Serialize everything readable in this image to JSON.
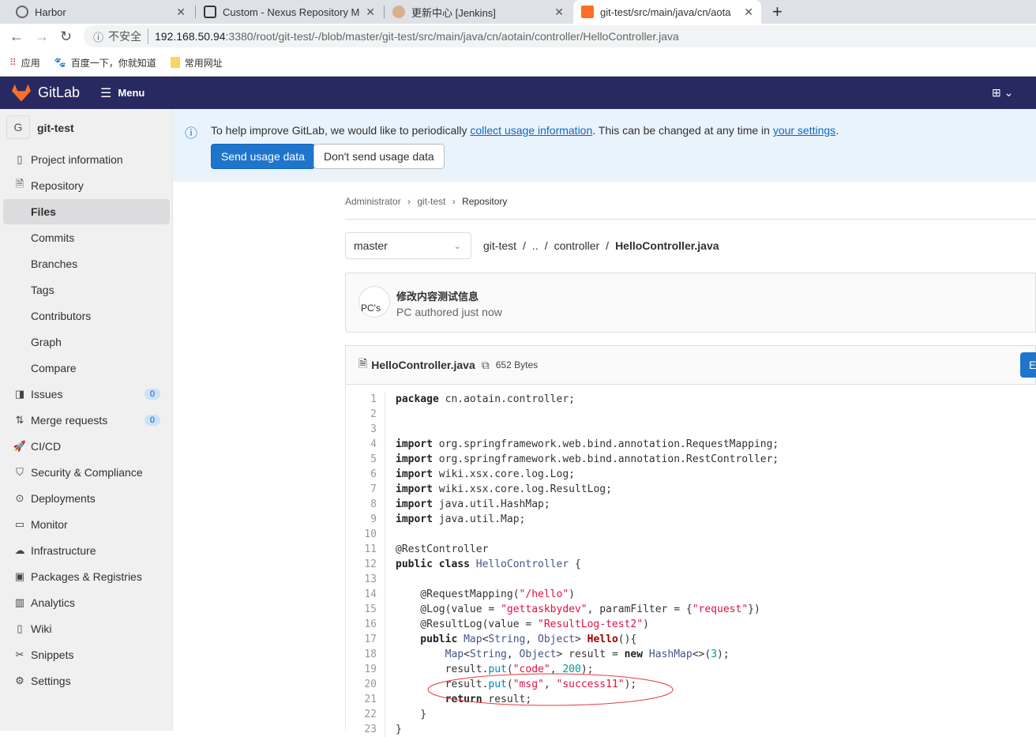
{
  "browser": {
    "tabs": [
      {
        "title": "Harbor"
      },
      {
        "title": "Custom - Nexus Repository M"
      },
      {
        "title": "更新中心 [Jenkins]"
      },
      {
        "title": "git-test/src/main/java/cn/aota",
        "active": true
      }
    ],
    "new_tab": "+",
    "security_label": "不安全",
    "url_host": "192.168.50.94",
    "url_path": ":3380/root/git-test/-/blob/master/git-test/src/main/java/cn/aotain/controller/HelloController.java",
    "bookmarks": [
      {
        "label": "应用",
        "icon": "apps-grid-icon"
      },
      {
        "label": "百度一下，你就知道",
        "icon": "baidu-paw-icon"
      },
      {
        "label": "常用网址",
        "icon": "folder-icon"
      }
    ]
  },
  "topnav": {
    "brand": "GitLab",
    "menu": "Menu"
  },
  "sidebar": {
    "project_initial": "G",
    "project_name": "git-test",
    "items": [
      {
        "label": "Project information",
        "icon": "info-doc-icon"
      },
      {
        "label": "Repository",
        "icon": "doc-icon"
      },
      {
        "label": "Files",
        "sub": true,
        "selected": true
      },
      {
        "label": "Commits",
        "sub": true
      },
      {
        "label": "Branches",
        "sub": true
      },
      {
        "label": "Tags",
        "sub": true
      },
      {
        "label": "Contributors",
        "sub": true
      },
      {
        "label": "Graph",
        "sub": true
      },
      {
        "label": "Compare",
        "sub": true
      },
      {
        "label": "Issues",
        "icon": "issues-icon",
        "badge": "0"
      },
      {
        "label": "Merge requests",
        "icon": "merge-request-icon",
        "badge": "0"
      },
      {
        "label": "CI/CD",
        "icon": "rocket-icon"
      },
      {
        "label": "Security & Compliance",
        "icon": "shield-icon"
      },
      {
        "label": "Deployments",
        "icon": "deployments-icon"
      },
      {
        "label": "Monitor",
        "icon": "monitor-icon"
      },
      {
        "label": "Infrastructure",
        "icon": "cloud-icon"
      },
      {
        "label": "Packages & Registries",
        "icon": "package-icon"
      },
      {
        "label": "Analytics",
        "icon": "chart-icon"
      },
      {
        "label": "Wiki",
        "icon": "book-icon"
      },
      {
        "label": "Snippets",
        "icon": "scissors-icon"
      },
      {
        "label": "Settings",
        "icon": "gear-icon"
      }
    ]
  },
  "banner": {
    "text1": "To help improve GitLab, we would like to periodically ",
    "link1": "collect usage information",
    "text2": ". This can be changed at any time in ",
    "link2": "your settings",
    "text3": ".",
    "send": "Send usage data",
    "dont_send": "Don't send usage data"
  },
  "breadcrumb": [
    "Administrator",
    "git-test",
    "Repository"
  ],
  "branch": "master",
  "path": [
    "git-test",
    "..",
    "controller",
    "HelloController.java"
  ],
  "commit": {
    "avatar_alt": "PC's",
    "message": "修改内容测试信息",
    "author": "PC",
    "meta": " authored just now"
  },
  "file": {
    "name": "HelloController.java",
    "size": "652 Bytes",
    "edit": "E"
  },
  "code_lines": [
    [
      [
        "kw",
        "package"
      ],
      [
        "",
        " cn.aotain.controller;"
      ]
    ],
    [],
    [],
    [
      [
        "kw",
        "import"
      ],
      [
        "",
        " org.springframework.web.bind.annotation.RequestMapping;"
      ]
    ],
    [
      [
        "kw",
        "import"
      ],
      [
        "",
        " org.springframework.web.bind.annotation.RestController;"
      ]
    ],
    [
      [
        "kw",
        "import"
      ],
      [
        "",
        " wiki.xsx.core.log.Log;"
      ]
    ],
    [
      [
        "kw",
        "import"
      ],
      [
        "",
        " wiki.xsx.core.log.ResultLog;"
      ]
    ],
    [
      [
        "kw",
        "import"
      ],
      [
        "",
        " java.util.HashMap;"
      ]
    ],
    [
      [
        "kw",
        "import"
      ],
      [
        "",
        " java.util.Map;"
      ]
    ],
    [],
    [
      [
        "",
        "@RestController"
      ]
    ],
    [
      [
        "kw",
        "public class "
      ],
      [
        "type",
        "HelloController"
      ],
      [
        "",
        " {"
      ]
    ],
    [],
    [
      [
        "",
        "    @RequestMapping("
      ],
      [
        "str",
        "\"/hello\""
      ],
      [
        "",
        ")"
      ]
    ],
    [
      [
        "",
        "    @Log(value = "
      ],
      [
        "str",
        "\"gettaskbydev\""
      ],
      [
        "",
        ", paramFilter = {"
      ],
      [
        "str",
        "\"request\""
      ],
      [
        "",
        "})"
      ]
    ],
    [
      [
        "",
        "    @ResultLog(value = "
      ],
      [
        "str",
        "\"ResultLog-test2\""
      ],
      [
        "",
        ")"
      ]
    ],
    [
      [
        "kw",
        "    public "
      ],
      [
        "type",
        "Map"
      ],
      [
        "",
        "<"
      ],
      [
        "type",
        "String"
      ],
      [
        "",
        ", "
      ],
      [
        "type",
        "Object"
      ],
      [
        "",
        "> "
      ],
      [
        "fn",
        "Hello"
      ],
      [
        "",
        "(){"
      ]
    ],
    [
      [
        "type",
        "        Map"
      ],
      [
        "",
        "<"
      ],
      [
        "type",
        "String"
      ],
      [
        "",
        ", "
      ],
      [
        "type",
        "Object"
      ],
      [
        "",
        "> result = "
      ],
      [
        "kw",
        "new "
      ],
      [
        "type",
        "HashMap"
      ],
      [
        "",
        "<>("
      ],
      [
        "num",
        "3"
      ],
      [
        "",
        ");"
      ]
    ],
    [
      [
        "",
        "        result."
      ],
      [
        "m",
        "put"
      ],
      [
        "",
        "("
      ],
      [
        "str",
        "\"code\""
      ],
      [
        "",
        ", "
      ],
      [
        "num",
        "200"
      ],
      [
        "",
        ");"
      ]
    ],
    [
      [
        "",
        "        result."
      ],
      [
        "m",
        "put"
      ],
      [
        "",
        "("
      ],
      [
        "str",
        "\"msg\""
      ],
      [
        "",
        ", "
      ],
      [
        "str",
        "\"success11\""
      ],
      [
        "",
        ");"
      ]
    ],
    [
      [
        "kw",
        "        return"
      ],
      [
        "",
        " result;"
      ]
    ],
    [
      [
        "",
        "    }"
      ]
    ],
    [
      [
        "",
        "}"
      ]
    ]
  ]
}
